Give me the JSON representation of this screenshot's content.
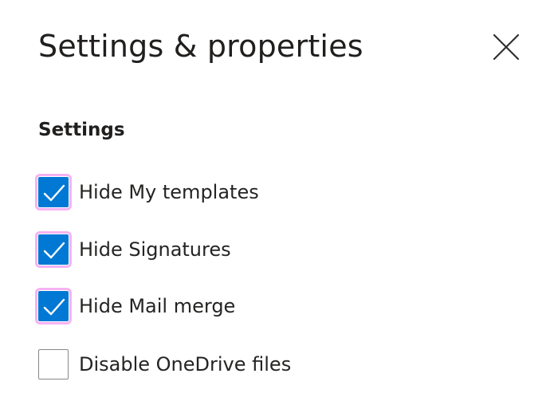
{
  "panel": {
    "title": "Settings & properties",
    "close_icon": "close-icon"
  },
  "settings": {
    "heading": "Settings",
    "options": [
      {
        "label": "Hide My templates",
        "checked": true
      },
      {
        "label": "Hide Signatures",
        "checked": true
      },
      {
        "label": "Hide Mail merge",
        "checked": true
      },
      {
        "label": "Disable OneDrive files",
        "checked": false
      }
    ]
  },
  "colors": {
    "accent": "#0078d4",
    "highlight": "#f6b3f2"
  }
}
